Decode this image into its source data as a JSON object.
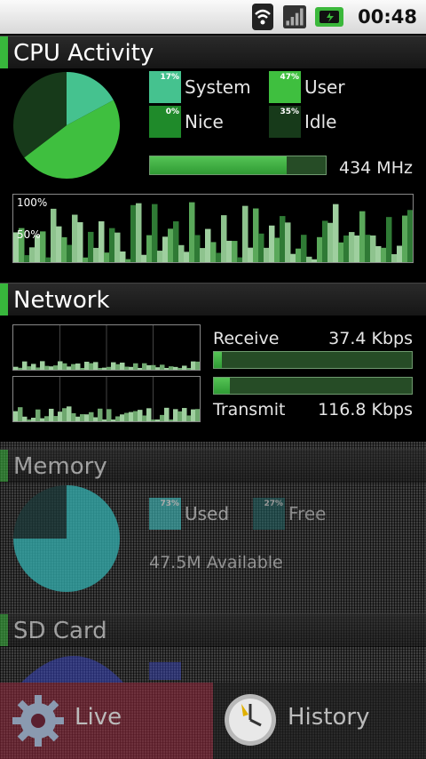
{
  "status_bar": {
    "time": "00:48",
    "icons": [
      "wifi-icon",
      "signal-icon",
      "battery-charging-icon"
    ]
  },
  "cpu": {
    "title": "CPU Activity",
    "legend": [
      {
        "pct": "17%",
        "label": "System",
        "color": "#45c28f"
      },
      {
        "pct": "47%",
        "label": "User",
        "color": "#3fbf3f"
      },
      {
        "pct": "0%",
        "label": "Nice",
        "color": "#1f8a2a"
      },
      {
        "pct": "35%",
        "label": "Idle",
        "color": "#173a1a"
      }
    ],
    "pie": [
      {
        "name": "System",
        "value": 17,
        "color": "#45c28f"
      },
      {
        "name": "User",
        "value": 47,
        "color": "#3fbf3f"
      },
      {
        "name": "Nice",
        "value": 0,
        "color": "#1f8a2a"
      },
      {
        "name": "Idle",
        "value": 35,
        "color": "#173a1a"
      }
    ],
    "freq_fraction": 0.78,
    "freq_text": "434 MHz",
    "graph_labels": {
      "top": "100%",
      "mid": "50%"
    }
  },
  "network": {
    "title": "Network",
    "receive_label": "Receive",
    "receive_value": "37.4 Kbps",
    "receive_fraction": 0.04,
    "transmit_label": "Transmit",
    "transmit_value": "116.8 Kbps",
    "transmit_fraction": 0.08
  },
  "memory": {
    "title": "Memory",
    "used_pct": "73%",
    "used_label": "Used",
    "free_pct": "27%",
    "free_label": "Free",
    "available_text": "47.5M Available",
    "used_fraction": 0.75
  },
  "sdcard": {
    "title": "SD Card"
  },
  "tabs": [
    {
      "label": "Live",
      "icon": "gear-icon"
    },
    {
      "label": "History",
      "icon": "clock-icon"
    }
  ]
}
